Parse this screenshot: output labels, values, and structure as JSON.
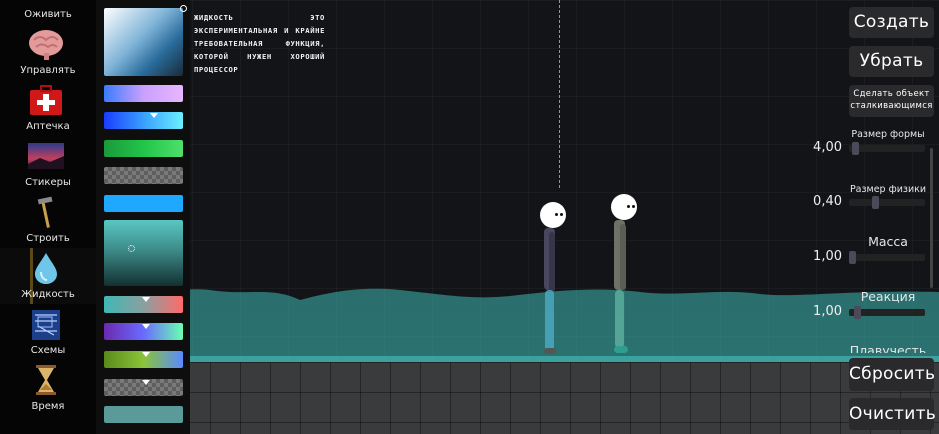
{
  "categories": [
    {
      "id": "revive",
      "label": "Оживить",
      "icon": "revive-icon"
    },
    {
      "id": "control",
      "label": "Управлять",
      "icon": "brain-icon"
    },
    {
      "id": "firstaid",
      "label": "Аптечка",
      "icon": "first-aid-kit-icon"
    },
    {
      "id": "stickers",
      "label": "Стикеры",
      "icon": "stickers-icon"
    },
    {
      "id": "build",
      "label": "Строить",
      "icon": "build-icon"
    },
    {
      "id": "liquid",
      "label": "Жидкость",
      "icon": "droplet-icon"
    },
    {
      "id": "schemes",
      "label": "Схемы",
      "icon": "schemes-icon"
    },
    {
      "id": "time",
      "label": "Время",
      "icon": "hourglass-icon"
    }
  ],
  "active_category": "liquid",
  "description": "Жидкость это экспериментальная и крайне требовательная функция, которой нужен хороший процессор",
  "colors": {
    "liquid": "#3fb8b4",
    "accent": "#5aa0c8",
    "panel_button": "#2a2a2c"
  },
  "right_panel": {
    "create_label": "Создать",
    "remove_label": "Убрать",
    "collide_label": "Сделать объект сталкивающимся",
    "reset_label": "Сбросить",
    "clear_label": "Очистить",
    "params": [
      {
        "label": "Размер формы",
        "value": "4,00",
        "fill": 0.08
      },
      {
        "label": "Размер физики",
        "value": "0,40",
        "fill": 0.35
      },
      {
        "label": "Масса",
        "value": "1,00",
        "fill": 0.0
      },
      {
        "label": "Реакция",
        "value": "1,00",
        "fill": 0.08
      },
      {
        "label": "Плавучесть",
        "value": ""
      }
    ]
  }
}
